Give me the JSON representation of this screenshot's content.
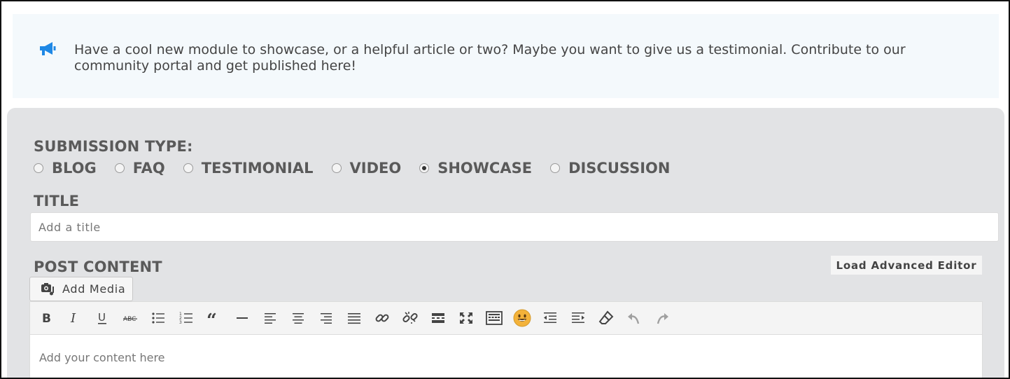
{
  "notice": {
    "icon": "megaphone-icon",
    "text": "Have a cool new module to showcase, or a helpful article or two? Maybe you want to give us a testimonial. Contribute to our community portal and get published here!",
    "icon_color": "#1e88e5"
  },
  "form": {
    "submission_type_label": "SUBMISSION TYPE:",
    "types": [
      {
        "label": "BLOG",
        "checked": false
      },
      {
        "label": "FAQ",
        "checked": false
      },
      {
        "label": "TESTIMONIAL",
        "checked": false
      },
      {
        "label": "VIDEO",
        "checked": false
      },
      {
        "label": "SHOWCASE",
        "checked": true
      },
      {
        "label": "DISCUSSION",
        "checked": false
      }
    ],
    "title_label": "TITLE",
    "title_placeholder": "Add a title",
    "title_value": "",
    "content_label": "POST CONTENT",
    "advanced_editor_label": "Load Advanced Editor",
    "add_media_label": "Add Media",
    "content_placeholder": "Add your content here"
  },
  "toolbar": [
    "bold-icon",
    "italic-icon",
    "underline-icon",
    "strikethrough-icon",
    "bullet-list-icon",
    "numbered-list-icon",
    "blockquote-icon",
    "horizontal-line-icon",
    "align-left-icon",
    "align-center-icon",
    "align-right-icon",
    "justify-icon",
    "link-icon",
    "unlink-icon",
    "read-more-icon",
    "fullscreen-icon",
    "keyboard-shortcuts-icon",
    "emoji-icon",
    "outdent-icon",
    "indent-icon",
    "clear-formatting-icon",
    "undo-icon",
    "redo-icon"
  ]
}
